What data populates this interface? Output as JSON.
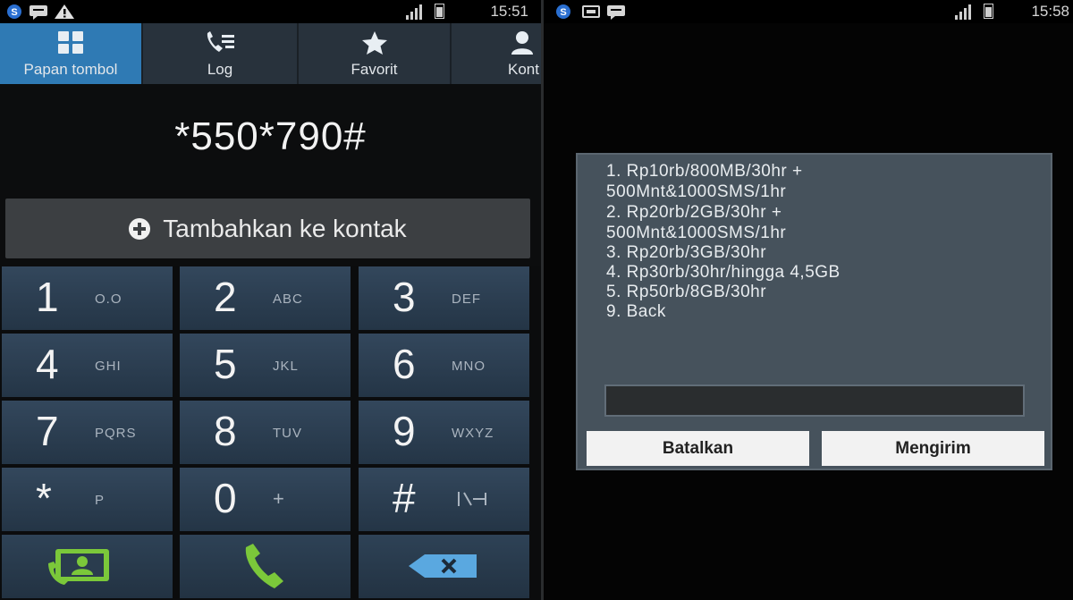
{
  "left": {
    "status": {
      "time": "15:51"
    },
    "tabs": [
      {
        "label": "Papan tombol",
        "icon": "keypad-icon",
        "active": true
      },
      {
        "label": "Log",
        "icon": "call-log-icon",
        "active": false
      },
      {
        "label": "Favorit",
        "icon": "star-icon",
        "active": false
      },
      {
        "label": "Kont",
        "icon": "contact-icon",
        "active": false
      }
    ],
    "dialed_number": "*550*790#",
    "add_contact_label": "Tambahkan ke kontak",
    "keys": [
      {
        "digit": "1",
        "letters": "O.O"
      },
      {
        "digit": "2",
        "letters": "ABC"
      },
      {
        "digit": "3",
        "letters": "DEF"
      },
      {
        "digit": "4",
        "letters": "GHI"
      },
      {
        "digit": "5",
        "letters": "JKL"
      },
      {
        "digit": "6",
        "letters": "MNO"
      },
      {
        "digit": "7",
        "letters": "PQRS"
      },
      {
        "digit": "8",
        "letters": "TUV"
      },
      {
        "digit": "9",
        "letters": "WXYZ"
      },
      {
        "digit": "*",
        "letters": "P"
      },
      {
        "digit": "0",
        "letters": "+"
      },
      {
        "digit": "#",
        "letters": ""
      }
    ],
    "colors": {
      "accent_tab": "#2f7ab4",
      "call_green": "#7bc83a",
      "delete_blue": "#5aa8e0"
    }
  },
  "right": {
    "status": {
      "time": "15:58"
    },
    "ussd_lines": [
      "1. Rp10rb/800MB/30hr +",
      "500Mnt&1000SMS/1hr",
      "2. Rp20rb/2GB/30hr +",
      "500Mnt&1000SMS/1hr",
      "3. Rp20rb/3GB/30hr",
      "4. Rp30rb/30hr/hingga 4,5GB",
      "5. Rp50rb/8GB/30hr",
      "9. Back"
    ],
    "input_value": "",
    "cancel_label": "Batalkan",
    "send_label": "Mengirim"
  }
}
